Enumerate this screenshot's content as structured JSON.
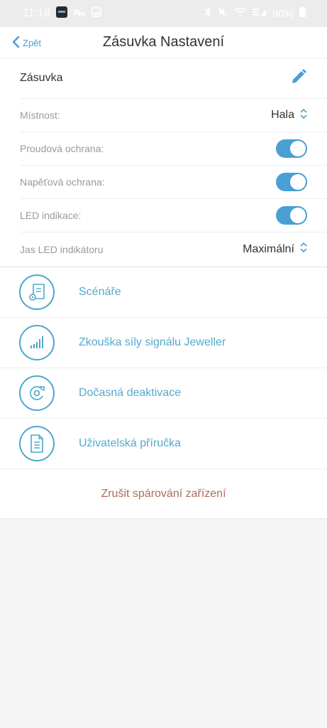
{
  "status_bar": {
    "time": "11:18",
    "battery": "90%"
  },
  "nav": {
    "back_label": "Zpět",
    "title": "Zásuvka Nastavení"
  },
  "device": {
    "name": "Zásuvka"
  },
  "settings": [
    {
      "label": "Místnost:",
      "value": "Hala",
      "type": "select"
    },
    {
      "label": "Proudová ochrana:",
      "type": "toggle",
      "on": true
    },
    {
      "label": "Napěťová ochrana:",
      "type": "toggle",
      "on": true
    },
    {
      "label": "LED indikace:",
      "type": "toggle",
      "on": true
    },
    {
      "label": "Jas LED indikátoru",
      "value": "Maximální",
      "type": "select"
    }
  ],
  "menu": [
    {
      "label": "Scénáře",
      "icon": "scenarios-icon"
    },
    {
      "label": "Zkouška síly signálu Jeweller",
      "icon": "signal-strength-icon"
    },
    {
      "label": "Dočasná deaktivace",
      "icon": "temporary-deactivation-icon"
    },
    {
      "label": "Uživatelská příručka",
      "icon": "user-manual-icon"
    }
  ],
  "unpair_label": "Zrušit spárování zařízení",
  "colors": {
    "accent": "#4a9fd5",
    "menu_text": "#55a9cc",
    "danger_text": "#b06a5c",
    "background": "#f5f5f5"
  }
}
